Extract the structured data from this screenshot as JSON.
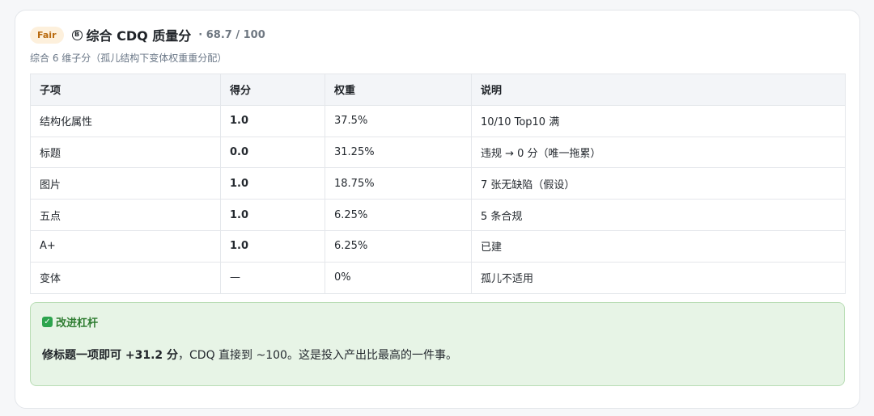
{
  "header": {
    "badge": "Fair",
    "grade_icon": "B",
    "title": "综合 CDQ 质量分",
    "score": "· 68.7 / 100"
  },
  "subtitle": "综合 6 维子分（孤儿结构下变体权重重分配）",
  "table": {
    "columns": [
      "子项",
      "得分",
      "权重",
      "说明"
    ],
    "rows": [
      {
        "item": "结构化属性",
        "score": "1.0",
        "status": "good",
        "weight": "37.5%",
        "note": "10/10 Top10 满"
      },
      {
        "item": "标题",
        "score": "0.0",
        "status": "bad",
        "weight": "31.25%",
        "note": "违规 → 0 分（唯一拖累）"
      },
      {
        "item": "图片",
        "score": "1.0",
        "status": "good",
        "weight": "18.75%",
        "note": "7 张无缺陷（假设）"
      },
      {
        "item": "五点",
        "score": "1.0",
        "status": "good",
        "weight": "6.25%",
        "note": "5 条合规"
      },
      {
        "item": "A+",
        "score": "1.0",
        "status": "good",
        "weight": "6.25%",
        "note": "已建"
      },
      {
        "item": "变体",
        "score": "—",
        "status": "none",
        "weight": "0%",
        "note": "孤儿不适用"
      }
    ]
  },
  "callout": {
    "icon": "check-icon",
    "title": "改进杠杆",
    "body_bold": "修标题一项即可 +31.2 分",
    "body_rest": "，CDQ 直接到 ~100。这是投入产出比最高的一件事。"
  },
  "colors": {
    "good": "#2f7d32",
    "bad": "#cc3b36",
    "badge_bg": "#fdf0dc",
    "badge_text": "#b96a0e",
    "callout_bg": "#e7f4e6"
  }
}
